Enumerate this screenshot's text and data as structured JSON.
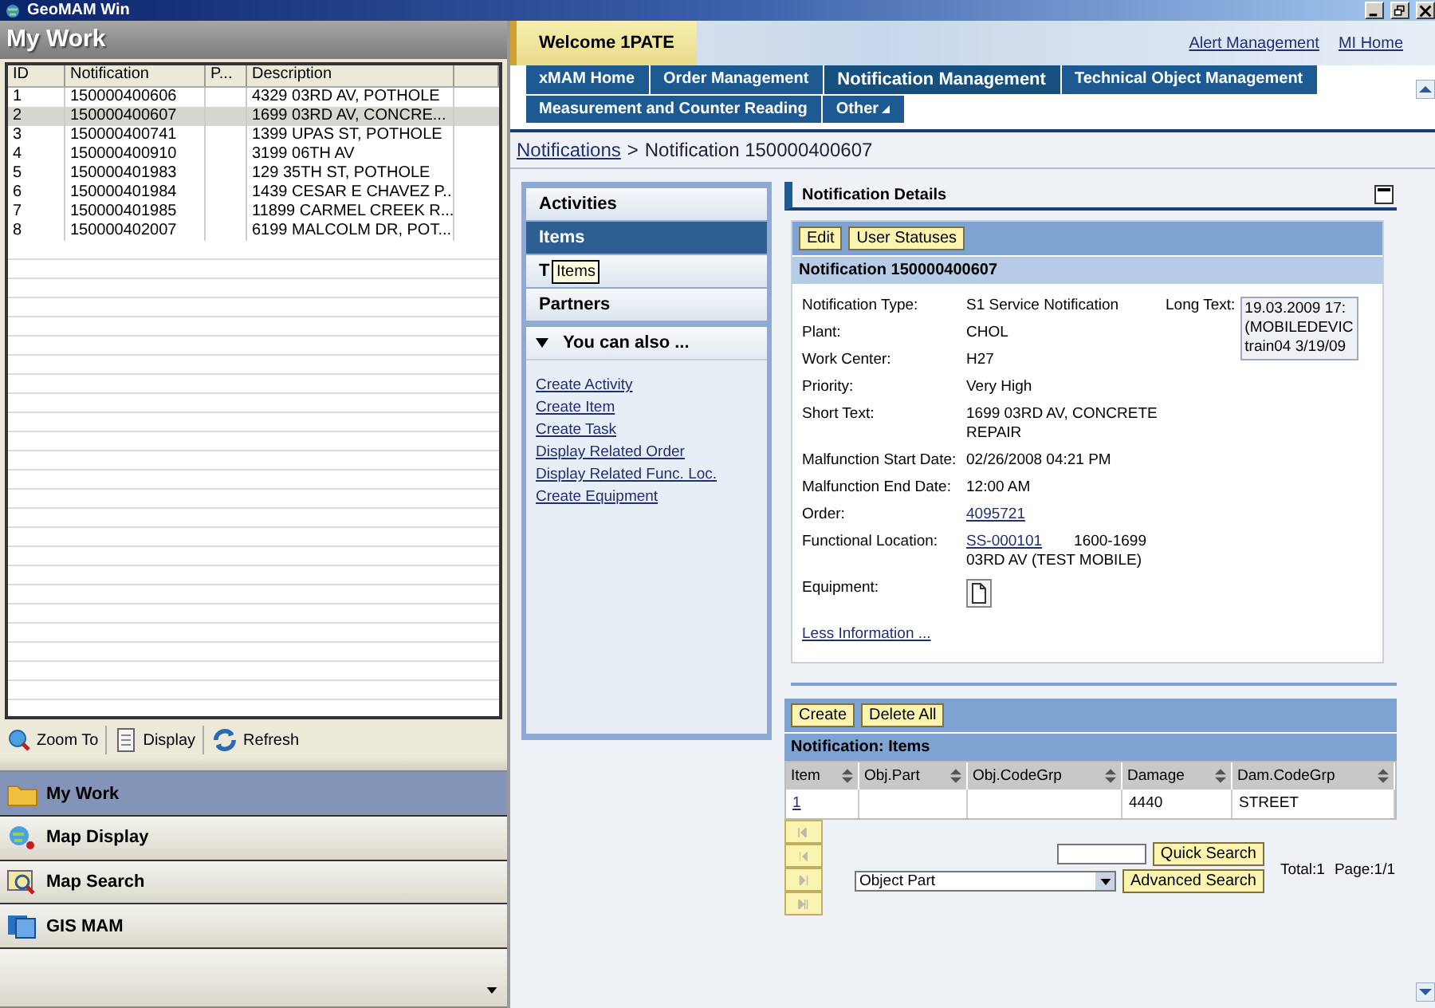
{
  "window": {
    "title": "GeoMAM Win"
  },
  "my_work": {
    "title": "My Work",
    "columns": [
      "ID",
      "Notification",
      "P...",
      "Description"
    ],
    "rows": [
      {
        "id": "1",
        "notification": "150000400606",
        "p": "",
        "description": "4329 03RD AV, POTHOLE",
        "selected": false
      },
      {
        "id": "2",
        "notification": "150000400607",
        "p": "",
        "description": "1699 03RD AV, CONCRE...",
        "selected": true
      },
      {
        "id": "3",
        "notification": "150000400741",
        "p": "",
        "description": "1399 UPAS ST, POTHOLE",
        "selected": false
      },
      {
        "id": "4",
        "notification": "150000400910",
        "p": "",
        "description": "3199 06TH AV",
        "selected": false
      },
      {
        "id": "5",
        "notification": "150000401983",
        "p": "",
        "description": "129 35TH ST, POTHOLE",
        "selected": false
      },
      {
        "id": "6",
        "notification": "150000401984",
        "p": "",
        "description": "1439 CESAR E CHAVEZ P...",
        "selected": false
      },
      {
        "id": "7",
        "notification": "150000401985",
        "p": "",
        "description": "11899 CARMEL CREEK R...",
        "selected": false
      },
      {
        "id": "8",
        "notification": "150000402007",
        "p": "",
        "description": "6199 MALCOLM DR, POT...",
        "selected": false
      }
    ],
    "toolbar": [
      {
        "label": "Zoom To",
        "kind": "zoom"
      },
      {
        "label": "Display",
        "kind": "display"
      },
      {
        "label": "Refresh",
        "kind": "refresh"
      }
    ],
    "nav": [
      {
        "label": "My Work",
        "kind": "folder",
        "selected": true
      },
      {
        "label": "Map Display",
        "kind": "globe",
        "selected": false
      },
      {
        "label": "Map Search",
        "kind": "search",
        "selected": false
      },
      {
        "label": "GIS MAM",
        "kind": "screens",
        "selected": false
      }
    ]
  },
  "header": {
    "welcome": "Welcome 1PATE",
    "links": [
      "Alert Management",
      "MI Home"
    ]
  },
  "nav_tabs": [
    [
      {
        "label": "xMAM Home",
        "selected": false
      },
      {
        "label": "Order Management",
        "selected": false
      },
      {
        "label": "Notification Management",
        "selected": true
      },
      {
        "label": "Technical Object Management",
        "selected": false
      }
    ],
    [
      {
        "label": "Measurement and Counter Reading",
        "selected": false
      },
      {
        "label": "Other",
        "selected": false,
        "has_menu": true
      }
    ]
  ],
  "breadcrumb": {
    "link": "Notifications",
    "separator": ">",
    "current": "Notification 150000400607"
  },
  "side_menu": {
    "items": [
      {
        "label": "Activities",
        "selected": false
      },
      {
        "label": "Items",
        "selected": true
      },
      {
        "label": "T",
        "selected": false
      },
      {
        "label": "Partners",
        "selected": false
      }
    ],
    "tooltip": "Items",
    "also": {
      "title": "You can also ...",
      "expanded": true,
      "links": [
        "Create Activity",
        "Create Item",
        "Create Task",
        "Display Related Order",
        "Display Related Func. Loc.",
        "Create Equipment"
      ]
    }
  },
  "details": {
    "title": "Notification Details",
    "buttons": [
      "Edit",
      "User Statuses"
    ],
    "heading": "Notification 150000400607",
    "fields": [
      {
        "label": "Notification Type:",
        "kind": "text",
        "value": "S1    Service Notification"
      },
      {
        "label": "Plant:",
        "kind": "text",
        "value": "CHOL"
      },
      {
        "label": "Work Center:",
        "kind": "text",
        "value": "H27"
      },
      {
        "label": "Priority:",
        "kind": "text",
        "value": "Very High"
      },
      {
        "label": "Short Text:",
        "kind": "text",
        "value": "1699 03RD AV, CONCRETE REPAIR"
      },
      {
        "label": "Malfunction Start Date:",
        "kind": "text",
        "value": "02/26/2008 04:21 PM"
      },
      {
        "label": "Malfunction End Date:",
        "kind": "text",
        "value": "12:00 AM"
      },
      {
        "label": "Order:",
        "kind": "link",
        "value": "4095721"
      },
      {
        "label": "Functional Location:",
        "kind": "link_text",
        "value": "SS-000101",
        "extra": "1600-1699 03RD AV (TEST MOBILE)"
      },
      {
        "label": "Equipment:",
        "kind": "icon"
      }
    ],
    "long_text": {
      "label": "Long Text:",
      "lines": [
        "19.03.2009 17:",
        "(MOBILEDEVIC",
        "train04 3/19/09"
      ]
    },
    "less_link": "Less Information ..."
  },
  "items": {
    "buttons": [
      "Create",
      "Delete All"
    ],
    "title": "Notification: Items",
    "columns": [
      "Item",
      "Obj.Part",
      "Obj.CodeGrp",
      "Damage",
      "Dam.CodeGrp"
    ],
    "rows": [
      {
        "item": "1",
        "obj_part": "",
        "obj_codegrp": "",
        "damage": "4440",
        "dam_codegrp": "STREET"
      }
    ],
    "search_select": "Object Part",
    "quick_search": "Quick Search",
    "advanced_search": "Advanced Search",
    "total": "Total:1",
    "page": "Page:1/1"
  }
}
